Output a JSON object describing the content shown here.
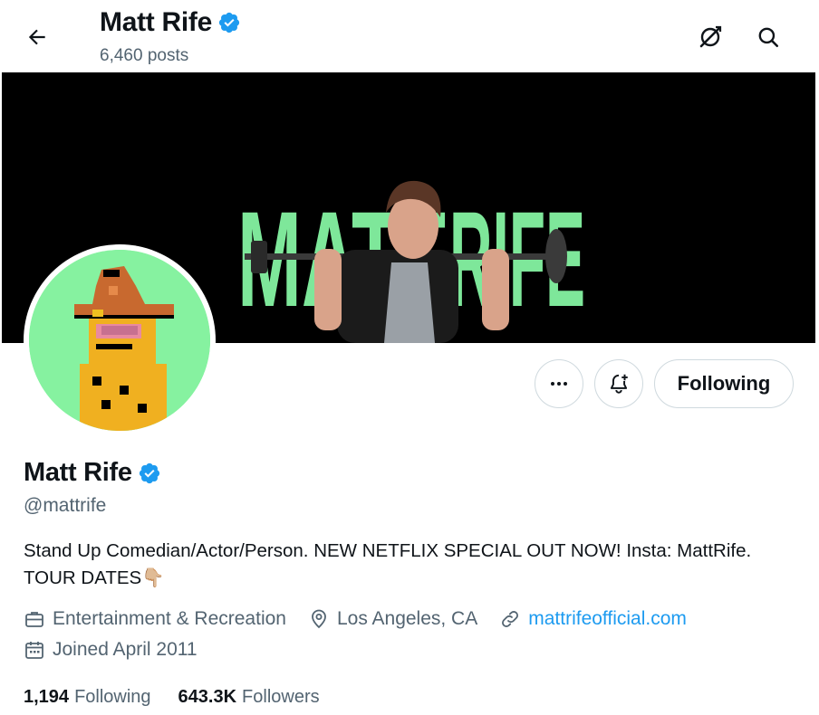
{
  "header": {
    "name": "Matt Rife",
    "posts_count": "6,460 posts"
  },
  "banner": {
    "text_left": "MATT",
    "text_right": "RIFE"
  },
  "actions": {
    "following_label": "Following"
  },
  "profile": {
    "name": "Matt Rife",
    "handle": "@mattrife",
    "bio": "Stand Up Comedian/Actor/Person.  NEW NETFLIX SPECIAL OUT NOW! Insta: MattRife. TOUR DATES👇🏼",
    "category": "Entertainment & Recreation",
    "location": "Los Angeles, CA",
    "website": "mattrifeofficial.com",
    "joined": "Joined April 2011"
  },
  "stats": {
    "following_count": "1,194",
    "following_label": "Following",
    "followers_count": "643.3K",
    "followers_label": "Followers"
  },
  "colors": {
    "accent": "#1d9bf0",
    "verified": "#1d9bf0",
    "secondary_text": "#536471",
    "avatar_bg": "#86f2a0",
    "banner_text": "#7ee79a"
  },
  "icons": {
    "back": "arrow-left-icon",
    "grok": "grok-icon",
    "search": "search-icon",
    "more": "more-dots-icon",
    "notify": "bell-plus-icon",
    "verified": "verified-badge-icon",
    "category": "briefcase-icon",
    "location": "location-pin-icon",
    "website": "link-icon",
    "joined": "calendar-icon"
  }
}
